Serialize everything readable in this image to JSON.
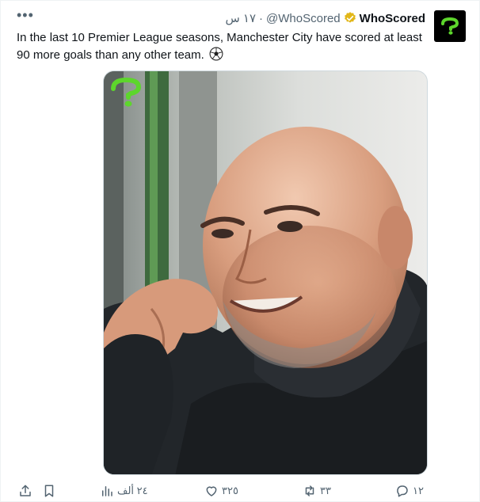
{
  "tweet": {
    "display_name": "WhoScored",
    "handle": "@WhoScored",
    "time": "١٧ س",
    "text": "In the last 10 Premier League seasons, Manchester City have scored at least 90 more goals than any other team."
  },
  "icons": {
    "more": "more-icon",
    "verified": "verified-badge-icon",
    "avatar": "whoscored-logo",
    "ball": "soccer-ball-emoji",
    "share": "share-icon",
    "bookmark": "bookmark-icon",
    "views": "views-chart-icon",
    "like": "heart-icon",
    "retweet": "retweet-icon",
    "reply": "reply-icon"
  },
  "media": {
    "overlay_logo": "whoscored-question-mark-logo"
  },
  "actions": {
    "views": "٢٤ ألف",
    "likes": "٣٢٥",
    "retweets": "٣٣",
    "replies": "١٢"
  },
  "colors": {
    "text": "#0f1419",
    "muted": "#536471",
    "verified": "#e2b719",
    "brand_green": "#5dd62c"
  }
}
